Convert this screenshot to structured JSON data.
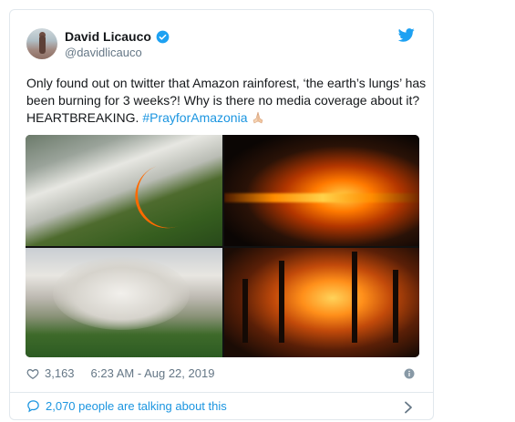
{
  "tweet": {
    "author_name": "David Licauco",
    "author_handle": "@davidlicauco",
    "text_main": "Only found out on twitter that Amazon rainforest, ‘the earth’s lungs’ has been burning for 3 weeks?! Why is there no media coverage about it? HEARTBREAKING. ",
    "hashtag": "#PrayforAmazonia",
    "like_count": "3,163",
    "timestamp": "6:23 AM - Aug 22, 2019",
    "talking_text": "2,070 people are talking about this"
  },
  "icons": {
    "verified": "verified-badge-icon",
    "bird": "twitter-bird-icon",
    "heart": "heart-icon",
    "info": "info-icon",
    "comment": "comment-bubble-icon",
    "chevron": "chevron-right-icon",
    "emoji": "praying-hands-emoji"
  },
  "colors": {
    "twitter_blue": "#1da1f2",
    "link_blue": "#1b95e0",
    "muted": "#657786",
    "text": "#14171a"
  }
}
